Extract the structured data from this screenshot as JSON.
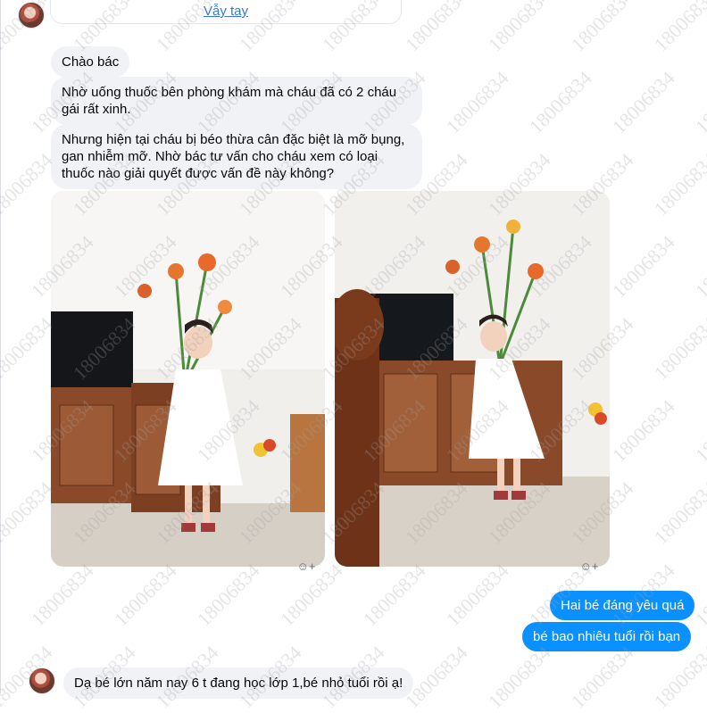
{
  "thread": {
    "wave_link": "Vẫy tay",
    "messages_in": [
      "Chào bác",
      "Nhờ uống thuốc bên phòng khám mà cháu đã có 2 cháu gái rất xinh.",
      "Nhưng hiện tại cháu bị béo thừa cân đặc biệt là mỡ bụng, gan nhiễm mỡ. Nhờ bác tư vấn cho cháu xem có loại thuốc nào giải quyết được vấn đề này không?"
    ],
    "messages_out": [
      "Hai bé đáng yêu quá",
      "bé bao nhiêu tuổi rồi bạn"
    ],
    "last_in": "Dạ bé lớn năm nay 6 t đang học lớp 1,bé nhỏ tuổi rồi ạ!"
  },
  "watermark_text": "18006834",
  "icons": {
    "react": "add-reaction-icon",
    "avatar": "user-avatar"
  },
  "colors": {
    "outgoing_bubble": "#0a91ff",
    "incoming_bubble": "#f0f2f5",
    "link": "#3578e5"
  }
}
